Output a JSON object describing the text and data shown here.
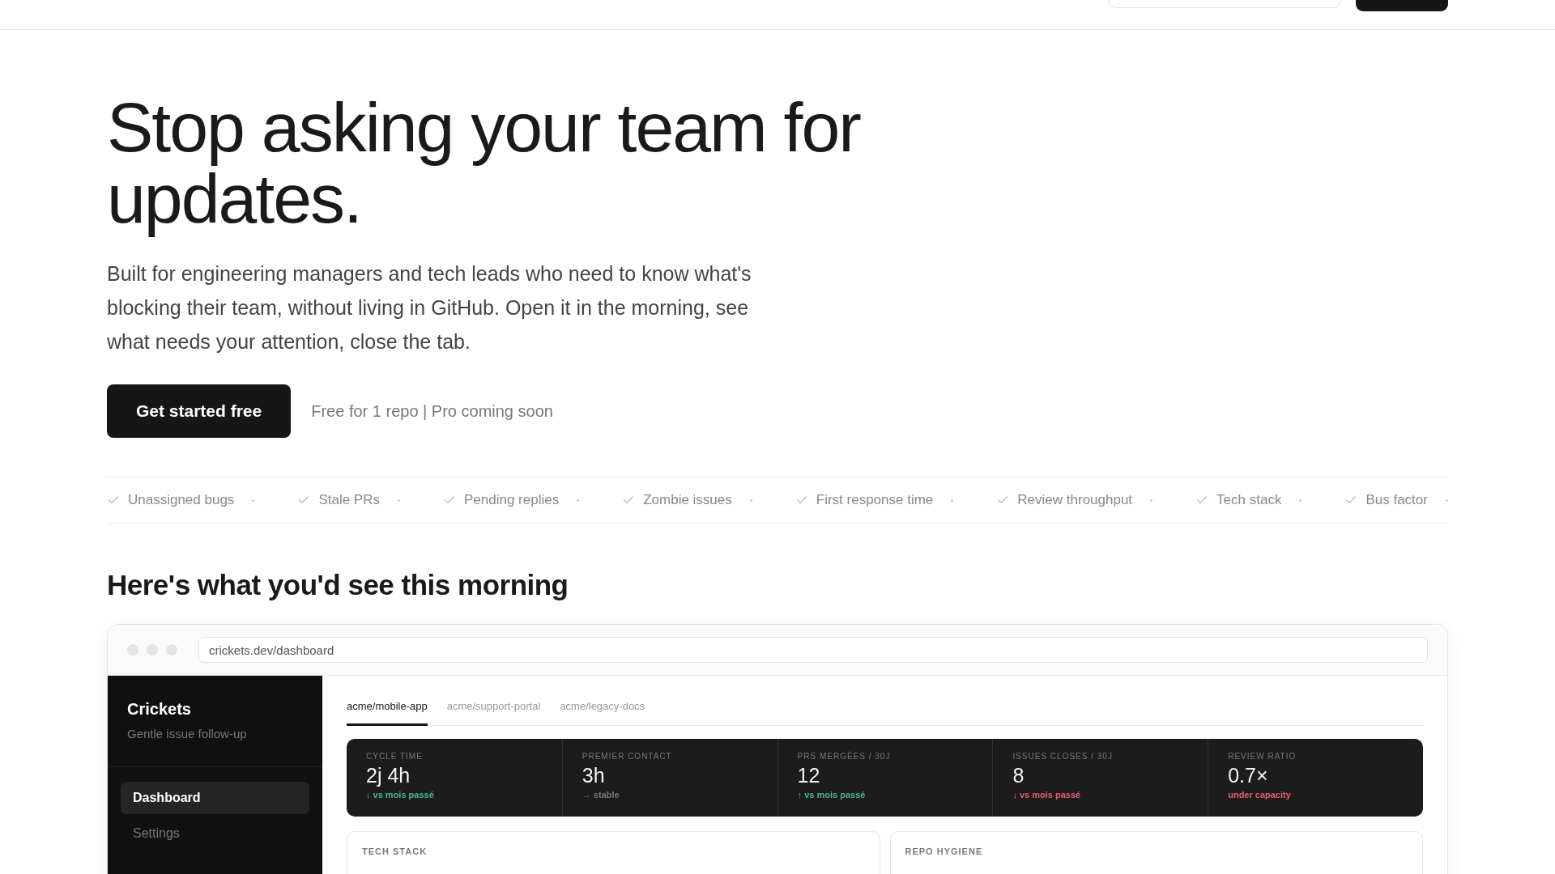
{
  "hero": {
    "title": "Stop asking your team for updates.",
    "subtitle": "Built for engineering managers and tech leads who need to know what's blocking their team, without living in GitHub. Open it in the morning, see what needs your attention, close the tab.",
    "cta": "Get started free",
    "note": "Free for 1 repo | Pro coming soon"
  },
  "features": [
    "Unassigned bugs",
    "Stale PRs",
    "Pending replies",
    "Zombie issues",
    "First response time",
    "Review throughput",
    "Tech stack",
    "Bus factor"
  ],
  "preview_heading": "Here's what you'd see this morning",
  "browser": {
    "url": "crickets.dev/dashboard"
  },
  "app": {
    "name": "Crickets",
    "tagline": "Gentle issue follow-up",
    "nav": [
      {
        "label": "Dashboard",
        "selected": true
      },
      {
        "label": "Settings",
        "selected": false
      }
    ],
    "tabs": [
      {
        "label": "acme/mobile-app",
        "selected": true
      },
      {
        "label": "acme/support-portal",
        "selected": false
      },
      {
        "label": "acme/legacy-docs",
        "selected": false
      }
    ],
    "stats": [
      {
        "label": "CYCLE TIME",
        "value": "2j 4h",
        "note": "↓ vs mois passé",
        "color": "#4cb782"
      },
      {
        "label": "PREMIER CONTACT",
        "value": "3h",
        "note": "→ stable",
        "color": "#777777"
      },
      {
        "label": "PRS MERGÉES / 30J",
        "value": "12",
        "note": "↑ vs mois passé",
        "color": "#4cb782"
      },
      {
        "label": "ISSUES CLOSES / 30J",
        "value": "8",
        "note": "↓ vs mois passé",
        "color": "#e0606e"
      },
      {
        "label": "REVIEW RATIO",
        "value": "0.7×",
        "note": "under capacity",
        "color": "#e0606e"
      }
    ],
    "cards": [
      {
        "title": "TECH STACK"
      },
      {
        "title": "REPO HYGIENE"
      }
    ]
  }
}
